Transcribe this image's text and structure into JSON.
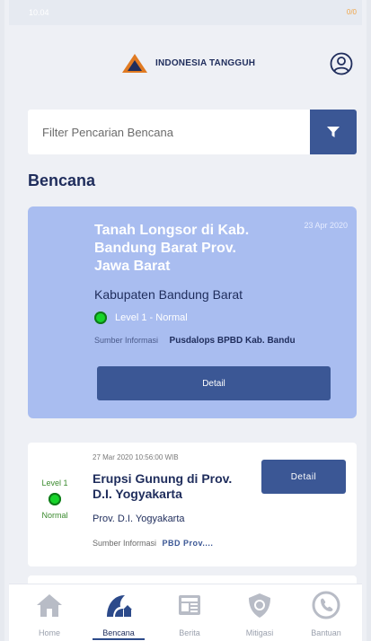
{
  "status_bar": {
    "time": "10.04",
    "battery": "0/0"
  },
  "header": {
    "brand": "INDONESIA TANGGUH"
  },
  "search": {
    "placeholder": "Filter Pencarian Bencana"
  },
  "section_title": "Bencana",
  "featured_card": {
    "title": "Tanah Longsor di Kab. Bandung Barat Prov. Jawa Barat",
    "date": "23 Apr 2020",
    "region": "Kabupaten Bandung Barat",
    "level": "Level 1 - Normal",
    "source_label": "Sumber Informasi",
    "source_value": "Pusdalops BPBD Kab. Bandu",
    "detail_label": "Detail"
  },
  "card2": {
    "date": "27 Mar 2020 10:56:00 WIB",
    "title": "Erupsi Gunung di Prov. D.I. Yogyakarta",
    "region": "Prov. D.I. Yogyakarta",
    "level_top": "Level 1",
    "level_bottom": "Normal",
    "source_label": "Sumber Informasi",
    "source_value": "PBD Prov....",
    "detail_label": "Detail"
  },
  "nav": [
    {
      "label": "Home",
      "icon": "home-icon"
    },
    {
      "label": "Bencana",
      "icon": "disaster-icon"
    },
    {
      "label": "Berita",
      "icon": "news-icon"
    },
    {
      "label": "Mitigasi",
      "icon": "shield-icon"
    },
    {
      "label": "Bantuan",
      "icon": "help-icon"
    }
  ],
  "colors": {
    "primary": "#3b5795",
    "card_highlight": "#a9bdf0",
    "level_green": "#16d42a",
    "text_dark": "#1f2d5c"
  }
}
